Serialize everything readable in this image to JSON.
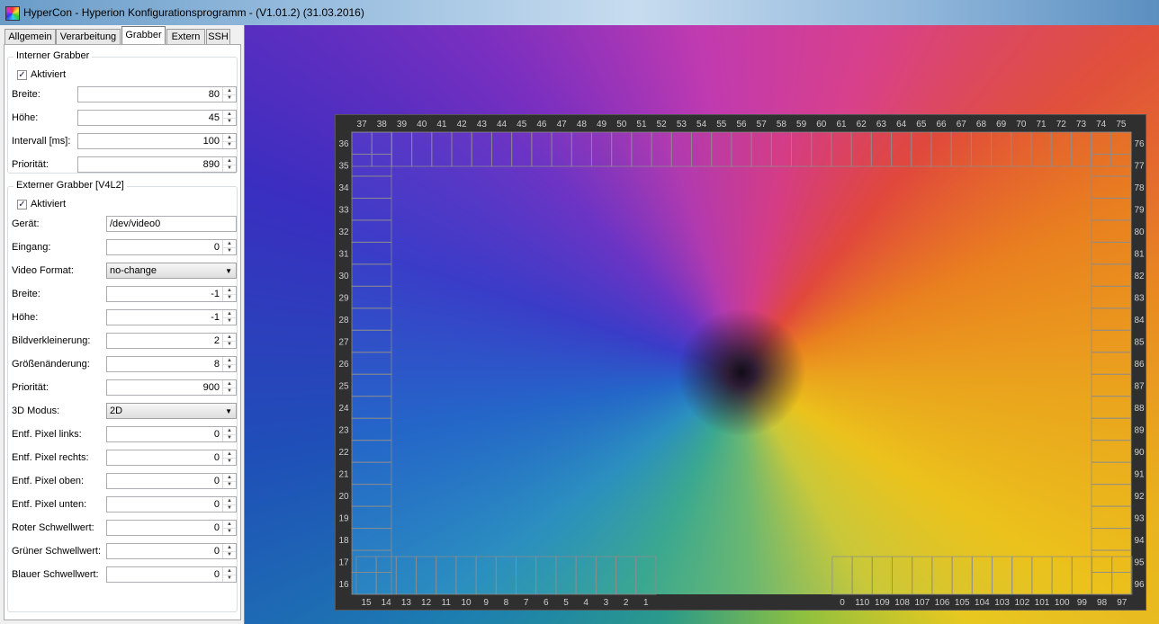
{
  "window": {
    "title": "HyperCon - Hyperion Konfigurationsprogramm - (V1.01.2) (31.03.2016)"
  },
  "tabs": [
    {
      "label": "Allgemein",
      "active": false
    },
    {
      "label": "Verarbeitung",
      "active": false
    },
    {
      "label": "Grabber",
      "active": true
    },
    {
      "label": "Extern",
      "active": false
    },
    {
      "label": "SSH",
      "active": false
    }
  ],
  "internal_grabber": {
    "title": "Interner Grabber",
    "enabled_label": "Aktiviert",
    "enabled": true,
    "fields": [
      {
        "label": "Breite:",
        "value": "80"
      },
      {
        "label": "Höhe:",
        "value": "45"
      },
      {
        "label": "Intervall [ms]:",
        "value": "100"
      },
      {
        "label": "Priorität:",
        "value": "890"
      }
    ]
  },
  "external_grabber": {
    "title": "Externer Grabber [V4L2]",
    "enabled_label": "Aktiviert",
    "enabled": true,
    "device_label": "Gerät:",
    "device_value": "/dev/video0",
    "input_label": "Eingang:",
    "input_value": "0",
    "video_format_label": "Video Format:",
    "video_format_value": "no-change",
    "fields": [
      {
        "label": "Breite:",
        "value": "-1"
      },
      {
        "label": "Höhe:",
        "value": "-1"
      },
      {
        "label": "Bildverkleinerung:",
        "value": "2"
      },
      {
        "label": "Größenänderung:",
        "value": "8"
      },
      {
        "label": "Priorität:",
        "value": "900"
      }
    ],
    "mode3d_label": "3D Modus:",
    "mode3d_value": "2D",
    "crop_fields": [
      {
        "label": "Entf. Pixel links:",
        "value": "0"
      },
      {
        "label": "Entf. Pixel rechts:",
        "value": "0"
      },
      {
        "label": "Entf. Pixel oben:",
        "value": "0"
      },
      {
        "label": "Entf. Pixel unten:",
        "value": "0"
      },
      {
        "label": "Roter Schwellwert:",
        "value": "0"
      },
      {
        "label": "Grüner Schwellwert:",
        "value": "0"
      },
      {
        "label": "Blauer Schwellwert:",
        "value": "0"
      }
    ]
  },
  "led_layout": {
    "top": [
      "37",
      "38",
      "39",
      "40",
      "41",
      "42",
      "43",
      "44",
      "45",
      "46",
      "47",
      "48",
      "49",
      "50",
      "51",
      "52",
      "53",
      "54",
      "55",
      "56",
      "57",
      "58",
      "59",
      "60",
      "61",
      "62",
      "63",
      "64",
      "65",
      "66",
      "67",
      "68",
      "69",
      "70",
      "71",
      "72",
      "73",
      "74",
      "75"
    ],
    "left": [
      "36",
      "35",
      "34",
      "33",
      "32",
      "31",
      "30",
      "29",
      "28",
      "27",
      "26",
      "25",
      "24",
      "23",
      "22",
      "21",
      "20",
      "19",
      "18",
      "17",
      "16"
    ],
    "right": [
      "76",
      "77",
      "78",
      "79",
      "80",
      "81",
      "82",
      "83",
      "84",
      "85",
      "86",
      "87",
      "88",
      "89",
      "90",
      "91",
      "92",
      "93",
      "94",
      "95",
      "96"
    ],
    "bottom_left": [
      "15",
      "14",
      "13",
      "12",
      "11",
      "10",
      "9",
      "8",
      "7",
      "6",
      "5",
      "4",
      "3",
      "2",
      "1"
    ],
    "bottom_right": [
      "0",
      "110",
      "109",
      "108",
      "107",
      "106",
      "105",
      "104",
      "103",
      "102",
      "101",
      "100",
      "99",
      "98",
      "97"
    ]
  }
}
